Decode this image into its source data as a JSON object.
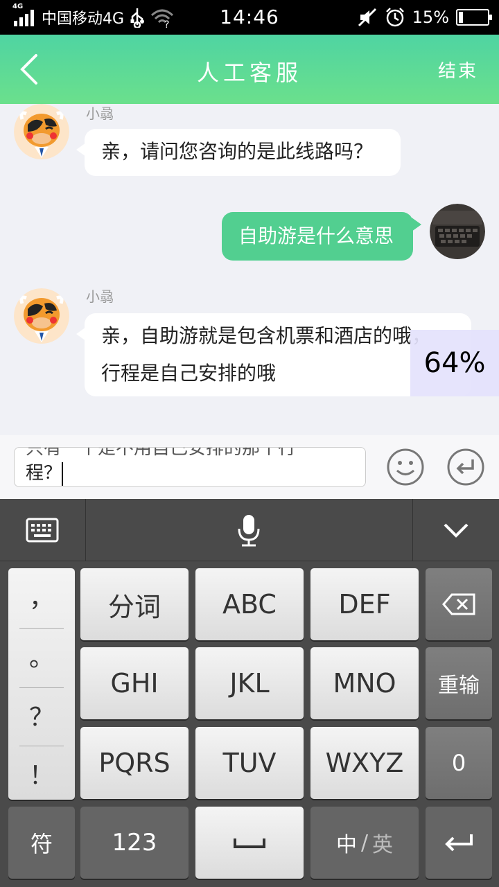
{
  "status_bar": {
    "net_tag": "4G",
    "carrier": "中国移动4G",
    "time": "14:46",
    "battery_pct": "15%",
    "battery_level": 0.15
  },
  "header": {
    "title": "人工客服",
    "end_label": "结束"
  },
  "chat": {
    "messages": [
      {
        "from": "agent",
        "sender": "小骉",
        "text": "亲，请问您咨询的是此线路吗？"
      },
      {
        "from": "user",
        "text": "自助游是什么意思"
      },
      {
        "from": "agent",
        "sender": "小骉",
        "lines": [
          "亲，自助游就是包含机票和酒店的哦，",
          "行程是自己安排的哦"
        ]
      }
    ],
    "progress_label": "64%"
  },
  "input": {
    "prev_line_fragment": "只有一个是不用自己安排的那个行",
    "current_text": "程？"
  },
  "keyboard": {
    "punctuation": [
      "，",
      "。",
      "？",
      "！"
    ],
    "keys": {
      "segment": "分词",
      "abc": "ABC",
      "def": "DEF",
      "ghi": "GHI",
      "jkl": "JKL",
      "mno": "MNO",
      "pqrs": "PQRS",
      "tuv": "TUV",
      "wxyz": "WXYZ",
      "reinput": "重输",
      "zero": "0",
      "symbols": "符",
      "numbers": "123",
      "lang_zh": "中",
      "lang_sep": "/",
      "lang_en": "英"
    },
    "icons": [
      "keyboard-icon",
      "microphone-icon",
      "chevron-down-icon",
      "backspace-icon",
      "enter-icon",
      "space-icon"
    ]
  },
  "colors": {
    "header_green": "#4fd4a2",
    "bubble_green": "#52cf90",
    "chat_bg": "#f0f1f6",
    "keyboard_bg": "#4a4a4a"
  }
}
